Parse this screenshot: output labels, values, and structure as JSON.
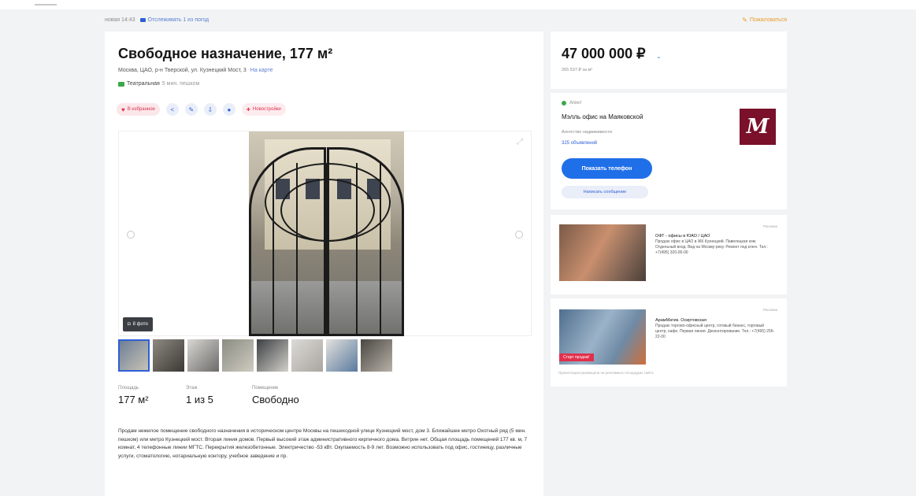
{
  "meta": {
    "views": "новая 14:43",
    "views_link": "Отслеживать 1 из погод",
    "complain": "Пожаловаться"
  },
  "listing": {
    "title": "Свободное назначение, 177 м²",
    "address": "Москва, ЦАО, р-н Тверской, ул. Кузнецкий Мост, 3",
    "map_link": "На карте",
    "metro_name": "Театральная",
    "metro_walk": "5 мин. пешком"
  },
  "actions": {
    "favorite": "В избранное",
    "new": "Новостройки"
  },
  "gallery": {
    "photo_count": "8 фото"
  },
  "specs": [
    {
      "key": "Площадь",
      "value": "177 м²"
    },
    {
      "key": "Этаж",
      "value": "1 из 5"
    },
    {
      "key": "Помещение",
      "value": "Свободно"
    }
  ],
  "description": "Продам нежилое помещение свободного назначения в историческом центре Москвы на пешеходной улице Кузнецкий мост, дом 3. Ближайшее метро Охотный ряд (5 мин. пешком) или метро Кузнецкий мост. Вторая линия домов. Первый высокий этаж административного кирпичного дома. Витрин нет. Общая площадь помещений 177 кв. м, 7 комнат, 4 телефонные линии МГТС. Перекрытия железобетонные. Электричество -53 кВт. Окупаемость 8-9 лет. Возможно использовать под офис, гостиницу, различные услуги, стоматологию, нотариальную контору, учебное заведение и пр.",
  "price": {
    "value": "47 000 000 ₽",
    "per_meter": "265 537 ₽ за м²"
  },
  "agent": {
    "status": "Агент",
    "name": "Мэлль офис на Маяковской",
    "type": "Агентство недвижимости",
    "ads": "325 объявлений",
    "logo_text": "M",
    "show_phone": "Показать телефон",
    "write": "Написать сообщение"
  },
  "ads": [
    {
      "label": "Реклама",
      "title": "ОФТ - офисы в ЮАО / ЦАО",
      "text": "Продаю офис в ЦАО в ЖК Кузнецкий. Павелецкая ком. Отдельный вход. Вид на Москву-реку. Ремонт под ключ. Тел.: +7(495) 320-00-00"
    },
    {
      "label": "Реклама",
      "badge": "Старт продаж!",
      "title": "АрамМатик. Осиртовская",
      "text": "Продаю торгово-офисный центр, готовый бизнес, торговый центр, кафе. Первая линия. Дисконтирование. Тел.: +7(495) 256-22-00",
      "footer": "Презентация размещена на рекламных площадках сайта"
    }
  ],
  "colors": {
    "accent": "#1f6fe8",
    "link": "#2f5fd6",
    "orange": "#e89b2c",
    "red": "#e1304c",
    "green": "#3aa94a"
  }
}
